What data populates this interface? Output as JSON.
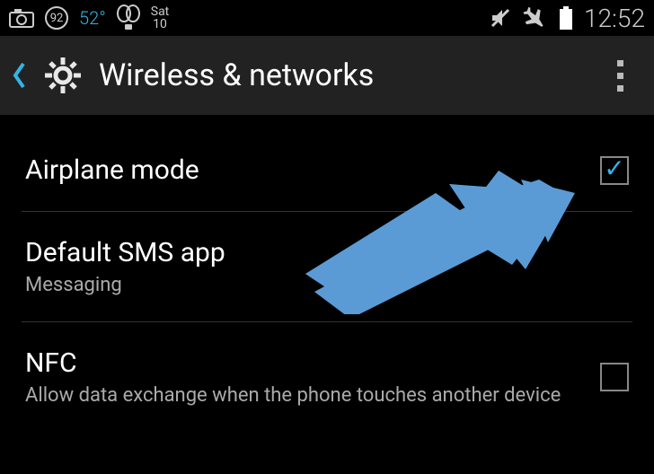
{
  "status": {
    "badge_num": "92",
    "temperature": "52°",
    "carrier_icon": "tmobile",
    "date_day": "Sat",
    "date_num": "10",
    "clock": "12:52"
  },
  "header": {
    "title": "Wireless & networks"
  },
  "settings": [
    {
      "title": "Airplane mode",
      "sub": "",
      "checked": true
    },
    {
      "title": "Default SMS app",
      "sub": "Messaging",
      "checked": null
    },
    {
      "title": "NFC",
      "sub": "Allow data exchange when the phone touches another device",
      "checked": false
    }
  ]
}
